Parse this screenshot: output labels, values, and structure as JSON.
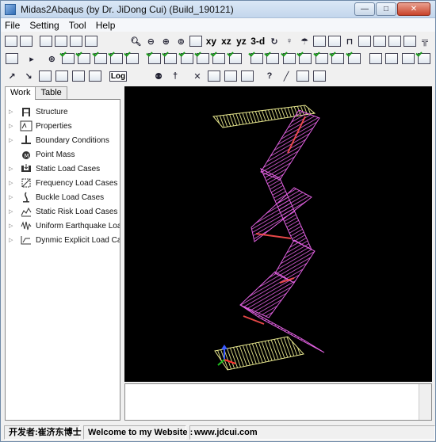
{
  "window": {
    "title": "Midas2Abaqus (by Dr. JiDong Cui) (Build_190121)"
  },
  "menu": [
    "File",
    "Setting",
    "Tool",
    "Help"
  ],
  "toolbar": {
    "xy": "xy",
    "xz": "xz",
    "yz": "yz",
    "three_d": "3-d",
    "log": "Log"
  },
  "tabs": [
    "Work",
    "Table"
  ],
  "tree": [
    {
      "label": "Structure",
      "icon": "structure-icon"
    },
    {
      "label": "Properties",
      "icon": "properties-icon"
    },
    {
      "label": "Boundary Conditions",
      "icon": "boundary-icon"
    },
    {
      "label": "Point Mass",
      "icon": "point-mass-icon"
    },
    {
      "label": "Static Load Cases",
      "icon": "static-load-icon"
    },
    {
      "label": "Frequency Load Cases",
      "icon": "frequency-load-icon"
    },
    {
      "label": "Buckle Load Cases",
      "icon": "buckle-load-icon"
    },
    {
      "label": "Static Risk Load Cases",
      "icon": "static-risk-icon"
    },
    {
      "label": "Uniform Earthquake Load",
      "icon": "earthquake-icon"
    },
    {
      "label": "Dynmic Explicit Load Case",
      "icon": "dynamic-explicit-icon"
    }
  ],
  "status": {
    "developer": "开发者:崔济东博士",
    "welcome": "Welcome to my Website :",
    "website": "www.jdcui.com"
  },
  "colors": {
    "viewport_bg": "#000000",
    "slab": "#e8e88e",
    "wall": "#e060e0",
    "edge": "#ff4f4f"
  }
}
